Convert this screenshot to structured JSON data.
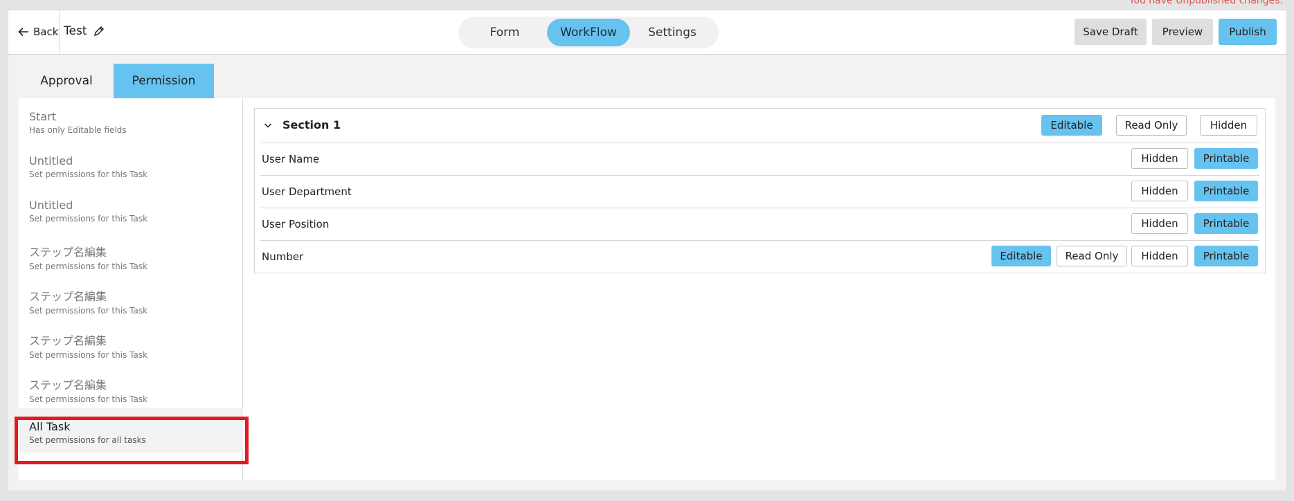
{
  "notice": "You have Unpublished changes.",
  "header": {
    "back_label": "Back",
    "title": "Test",
    "segments": [
      "Form",
      "WorkFlow",
      "Settings"
    ],
    "active_segment": "WorkFlow",
    "buttons": {
      "save_draft": "Save Draft",
      "preview": "Preview",
      "publish": "Publish"
    }
  },
  "tabs": {
    "approval": "Approval",
    "permission": "Permission",
    "active": "Permission"
  },
  "sidebar": {
    "items": [
      {
        "name": "Start",
        "desc": "Has only Editable fields"
      },
      {
        "name": "Untitled",
        "desc": "Set permissions for this Task"
      },
      {
        "name": "Untitled",
        "desc": "Set permissions for this Task"
      },
      {
        "name": "ステップ名編集",
        "desc": "Set permissions for this Task"
      },
      {
        "name": "ステップ名編集",
        "desc": "Set permissions for this Task"
      },
      {
        "name": "ステップ名編集",
        "desc": "Set permissions for this Task"
      },
      {
        "name": "ステップ名編集",
        "desc": "Set permissions for this Task"
      },
      {
        "name": "All Task",
        "desc": "Set permissions for all tasks"
      }
    ],
    "active_item": "All Task"
  },
  "section": {
    "title": "Section 1",
    "buttons": {
      "editable": "Editable",
      "read_only": "Read Only",
      "hidden": "Hidden"
    },
    "selected": "Editable",
    "rows": [
      {
        "label": "User Name",
        "hidden": "Hidden",
        "printable": "Printable"
      },
      {
        "label": "User Department",
        "hidden": "Hidden",
        "printable": "Printable"
      },
      {
        "label": "User Position",
        "hidden": "Hidden",
        "printable": "Printable"
      },
      {
        "label": "Number",
        "editable": "Editable",
        "read_only": "Read Only",
        "hidden": "Hidden",
        "printable": "Printable"
      }
    ]
  },
  "colors": {
    "accent": "#66c2ef",
    "highlight": "#e5191f",
    "notice": "#d9534f"
  }
}
